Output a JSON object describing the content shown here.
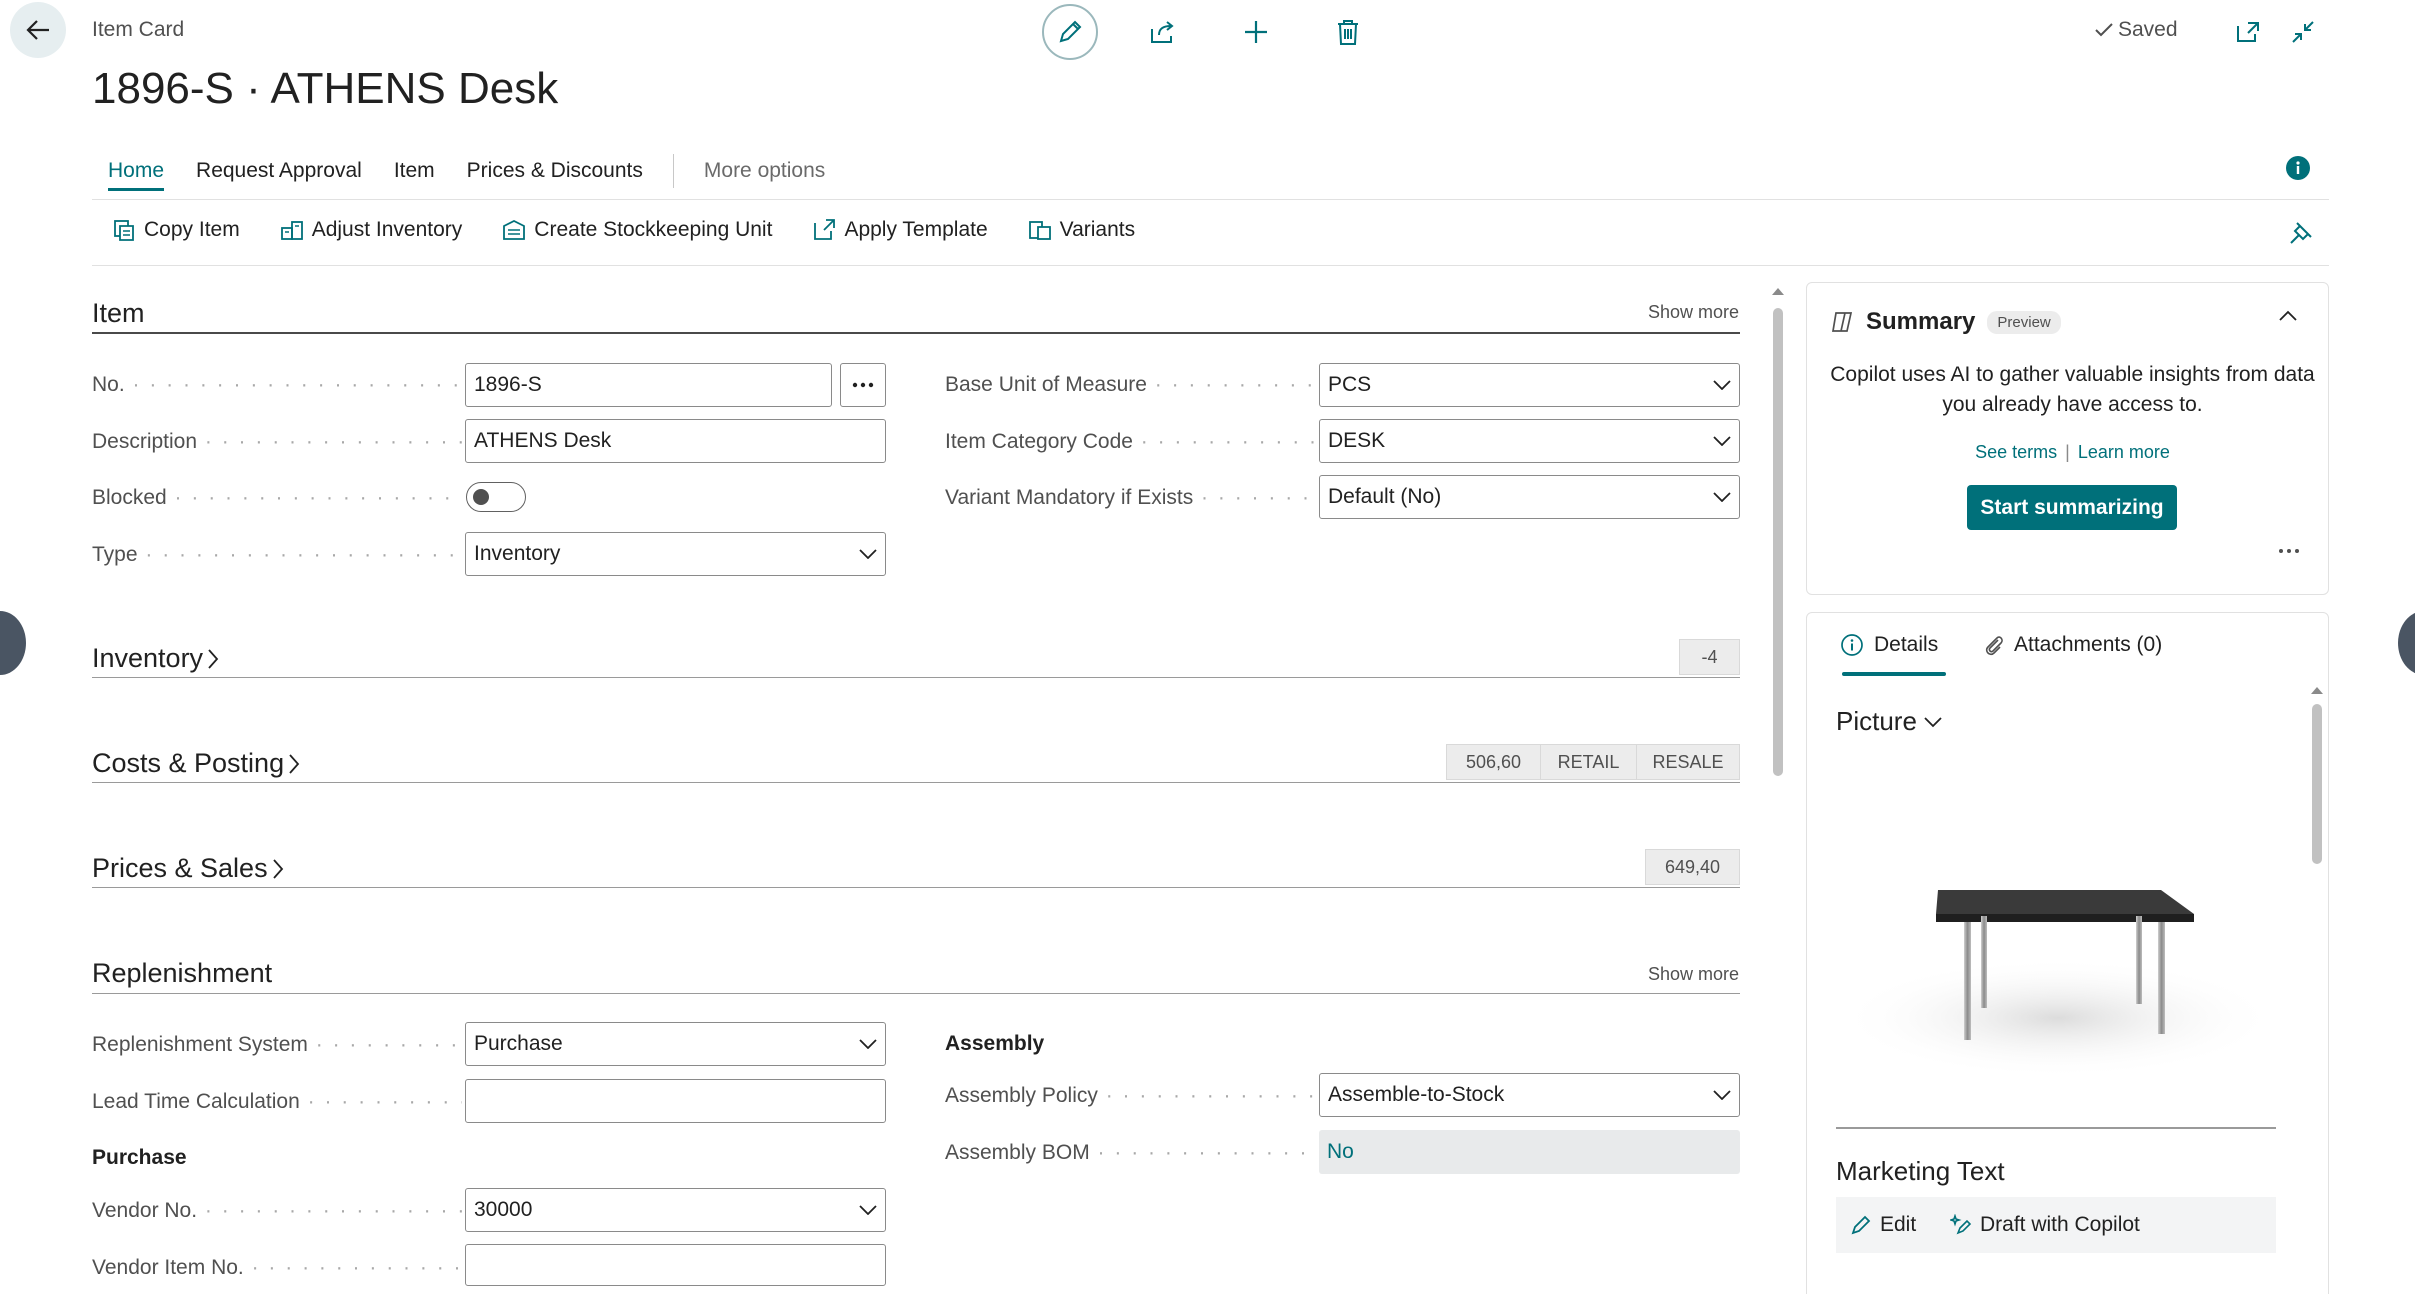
{
  "header": {
    "breadcrumb": "Item Card",
    "title": "1896-S · ATHENS Desk",
    "saved_label": "Saved"
  },
  "tabs": [
    {
      "label": "Home",
      "active": true
    },
    {
      "label": "Request Approval"
    },
    {
      "label": "Item"
    },
    {
      "label": "Prices & Discounts"
    },
    {
      "label": "More options"
    }
  ],
  "actions": [
    {
      "label": "Copy Item",
      "icon": "copy-icon"
    },
    {
      "label": "Adjust Inventory",
      "icon": "adjust-inventory-icon"
    },
    {
      "label": "Create Stockkeeping Unit",
      "icon": "stockkeeping-icon"
    },
    {
      "label": "Apply Template",
      "icon": "template-icon"
    },
    {
      "label": "Variants",
      "icon": "variants-icon"
    }
  ],
  "item_section": {
    "title": "Item",
    "show_more": "Show more",
    "fields": {
      "no_label": "No.",
      "no_value": "1896-S",
      "description_label": "Description",
      "description_value": "ATHENS Desk",
      "blocked_label": "Blocked",
      "type_label": "Type",
      "type_value": "Inventory",
      "base_uom_label": "Base Unit of Measure",
      "base_uom_value": "PCS",
      "category_label": "Item Category Code",
      "category_value": "DESK",
      "variant_label": "Variant Mandatory if Exists",
      "variant_value": "Default (No)"
    }
  },
  "collapsed_sections": {
    "inventory": {
      "title": "Inventory",
      "badge": "-4"
    },
    "costs": {
      "title": "Costs & Posting",
      "badge1": "506,60",
      "badge2": "RETAIL",
      "badge3": "RESALE"
    },
    "prices": {
      "title": "Prices & Sales",
      "badge": "649,40"
    }
  },
  "replenishment": {
    "title": "Replenishment",
    "show_more": "Show more",
    "system_label": "Replenishment System",
    "system_value": "Purchase",
    "lead_time_label": "Lead Time Calculation",
    "lead_time_value": "",
    "purchase_heading": "Purchase",
    "vendor_no_label": "Vendor No.",
    "vendor_no_value": "30000",
    "vendor_item_label": "Vendor Item No.",
    "vendor_item_value": "",
    "assembly_heading": "Assembly",
    "assembly_policy_label": "Assembly Policy",
    "assembly_policy_value": "Assemble-to-Stock",
    "assembly_bom_label": "Assembly BOM",
    "assembly_bom_value": "No"
  },
  "summary": {
    "title": "Summary",
    "badge": "Preview",
    "text": "Copilot uses AI to gather valuable insights from data you already have access to.",
    "see_terms": "See terms",
    "separator": "|",
    "learn_more": "Learn more",
    "button": "Start summarizing"
  },
  "factbox": {
    "details_tab": "Details",
    "attachments_tab": "Attachments (0)",
    "picture_title": "Picture",
    "marketing_title": "Marketing Text",
    "edit_label": "Edit",
    "draft_label": "Draft with Copilot"
  },
  "colors": {
    "accent": "#00707a",
    "muted_text": "#505050"
  }
}
